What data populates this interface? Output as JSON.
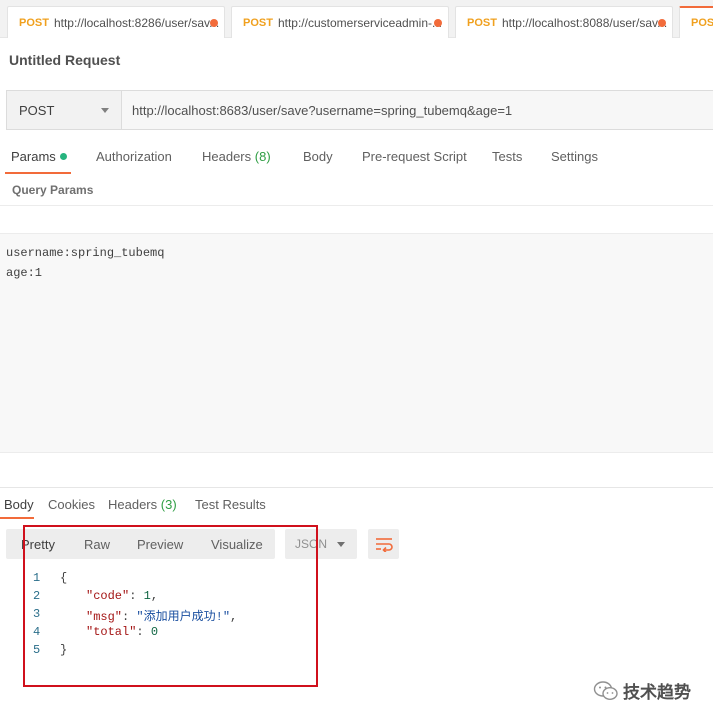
{
  "tabs": [
    {
      "method": "POST",
      "url": "http://localhost:8286/user/sav...",
      "unsaved": true
    },
    {
      "method": "POST",
      "url": "http://customerserviceadmin-...",
      "unsaved": true
    },
    {
      "method": "POST",
      "url": "http://localhost:8088/user/sav...",
      "unsaved": true
    },
    {
      "method": "POST",
      "url": "",
      "active": true
    }
  ],
  "request": {
    "title": "Untitled Request",
    "method": "POST",
    "url": "http://localhost:8683/user/save?username=spring_tubemq&age=1"
  },
  "request_tabs": {
    "params": "Params",
    "authorization": "Authorization",
    "headers": "Headers",
    "headers_count": "(8)",
    "body": "Body",
    "prerequest": "Pre-request Script",
    "tests": "Tests",
    "settings": "Settings"
  },
  "query_params_label": "Query Params",
  "bulk_lines": [
    "username:spring_tubemq",
    "age:1"
  ],
  "response_tabs": {
    "body": "Body",
    "cookies": "Cookies",
    "headers": "Headers",
    "headers_count": "(3)",
    "test_results": "Test Results"
  },
  "view_modes": {
    "pretty": "Pretty",
    "raw": "Raw",
    "preview": "Preview",
    "visualize": "Visualize"
  },
  "format": "JSON",
  "response_code": {
    "line_numbers": [
      "1",
      "2",
      "3",
      "4",
      "5"
    ],
    "open": "{",
    "code_key": "\"code\"",
    "code_val": "1",
    "msg_key": "\"msg\"",
    "msg_val": "\"添加用户成功!\"",
    "total_key": "\"total\"",
    "total_val": "0",
    "close": "}"
  },
  "watermark": "技术趋势",
  "colors": {
    "accent": "#f26b3a",
    "method_post": "#f0a01e",
    "count_green": "#2f9e44",
    "highlight_red": "#d0101c"
  }
}
